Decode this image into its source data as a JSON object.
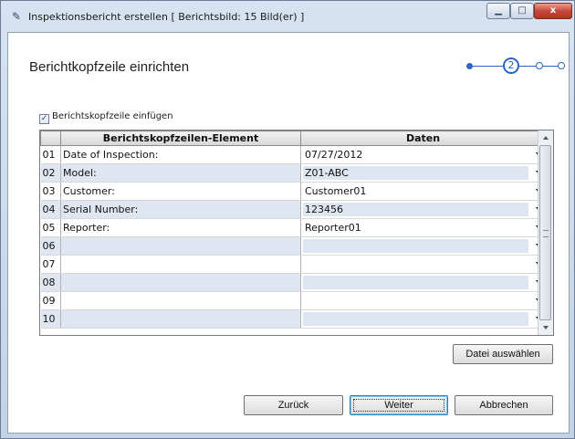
{
  "window": {
    "title": "Inspektionsbericht erstellen  [ Berichtsbild: 15 Bild(er) ]",
    "controls": {
      "minimize": "▁",
      "maximize": "□",
      "close": "x"
    }
  },
  "page": {
    "heading": "Berichtkopfzeile einrichten",
    "step_current": "2",
    "accent_color": "#2b66c2"
  },
  "checkbox": {
    "label": "Berichtskopfzeile einfügen",
    "checked": true,
    "mark": "✓"
  },
  "grid": {
    "columns": [
      "Berichtskopfzeilen-Element",
      "Daten"
    ],
    "rows": [
      {
        "num": "01",
        "element": "Date of Inspection:",
        "data": "07/27/2012"
      },
      {
        "num": "02",
        "element": "Model:",
        "data": "Z01-ABC"
      },
      {
        "num": "03",
        "element": "Customer:",
        "data": "Customer01"
      },
      {
        "num": "04",
        "element": "Serial Number:",
        "data": "123456"
      },
      {
        "num": "05",
        "element": "Reporter:",
        "data": "Reporter01"
      },
      {
        "num": "06",
        "element": "",
        "data": ""
      },
      {
        "num": "07",
        "element": "",
        "data": ""
      },
      {
        "num": "08",
        "element": "",
        "data": ""
      },
      {
        "num": "09",
        "element": "",
        "data": ""
      },
      {
        "num": "10",
        "element": "",
        "data": ""
      }
    ]
  },
  "buttons": {
    "select_file": "Datei auswählen",
    "back": "Zurück",
    "next": "Weiter",
    "cancel": "Abbrechen"
  }
}
